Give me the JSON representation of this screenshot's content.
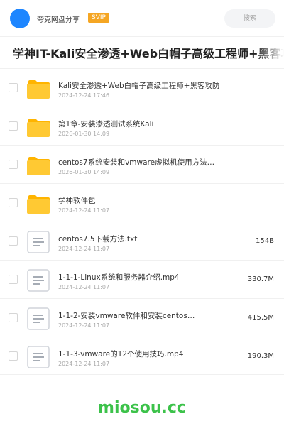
{
  "header": {
    "brand_name": "夸克网盘分享",
    "vip_badge": "SVIP",
    "search_label": "搜索"
  },
  "page": {
    "title": "学神IT-Kali安全渗透+Web白帽子高级工程师+黑客攻防"
  },
  "files": [
    {
      "type": "folder",
      "name": "Kali安全渗透+Web白帽子高级工程师+黑客攻防",
      "date": "2024-12-24 17:46",
      "size": ""
    },
    {
      "type": "folder",
      "name": "第1章-安装渗透测试系统Kali",
      "date": "2026-01-30 14:09",
      "size": ""
    },
    {
      "type": "folder",
      "name": "centos7系统安装和vmware虚拟机使用方法…",
      "date": "2026-01-30 14:09",
      "size": ""
    },
    {
      "type": "folder",
      "name": "学神软件包",
      "date": "2024-12-24 11:07",
      "size": ""
    },
    {
      "type": "file",
      "name": "centos7.5下载方法.txt",
      "date": "2024-12-24 11:07",
      "size": "154B"
    },
    {
      "type": "file",
      "name": "1-1-1-Linux系统和服务器介绍.mp4",
      "date": "2024-12-24 11:07",
      "size": "330.7M"
    },
    {
      "type": "file",
      "name": "1-1-2-安装vmware软件和安装centos…",
      "date": "2024-12-24 11:07",
      "size": "415.5M"
    },
    {
      "type": "file",
      "name": "1-1-3-vmware的12个使用技巧.mp4",
      "date": "2024-12-24 11:07",
      "size": "190.3M"
    }
  ],
  "icons": {
    "folder": "folder-icon",
    "file": "document-icon"
  },
  "colors": {
    "folder": "#ffc933",
    "folder_tab": "#ffb400",
    "file_border": "#d0d4da",
    "accent": "#1e86ff",
    "vip": "#f5a623",
    "watermark": "#3cc24a"
  },
  "watermark": "miosou.cc"
}
